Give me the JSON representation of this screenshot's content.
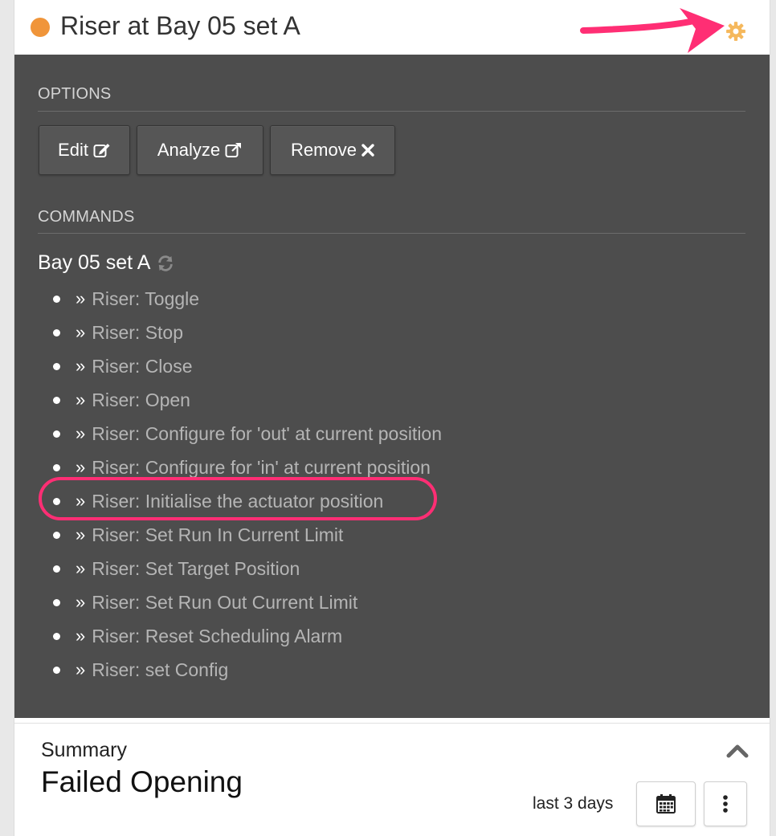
{
  "widget": {
    "title": "Riser at Bay 05 set A",
    "status_color": "#f0953a",
    "settings_icon": "gear-icon"
  },
  "options": {
    "heading": "OPTIONS",
    "buttons": [
      {
        "label": "Edit",
        "icon": "edit-icon"
      },
      {
        "label": "Analyze",
        "icon": "external-link-icon"
      },
      {
        "label": "Remove",
        "icon": "close-icon"
      }
    ]
  },
  "commands": {
    "heading": "COMMANDS",
    "group_title": "Bay 05 set A",
    "group_icon": "refresh-icon",
    "items": [
      "Riser: Toggle",
      "Riser: Stop",
      "Riser: Close",
      "Riser: Open",
      "Riser: Configure for 'out' at current position",
      "Riser: Configure for 'in' at current position",
      "Riser: Initialise the actuator position",
      "Riser: Set Run In Current Limit",
      "Riser: Set Target Position",
      "Riser: Set Run Out Current Limit",
      "Riser: Reset Scheduling Alarm",
      "Riser: set Config"
    ],
    "highlighted_index": 6
  },
  "summary": {
    "label": "Summary",
    "value": "Failed Opening",
    "range": "last 3 days"
  },
  "annotation_color": "#ff2e74"
}
